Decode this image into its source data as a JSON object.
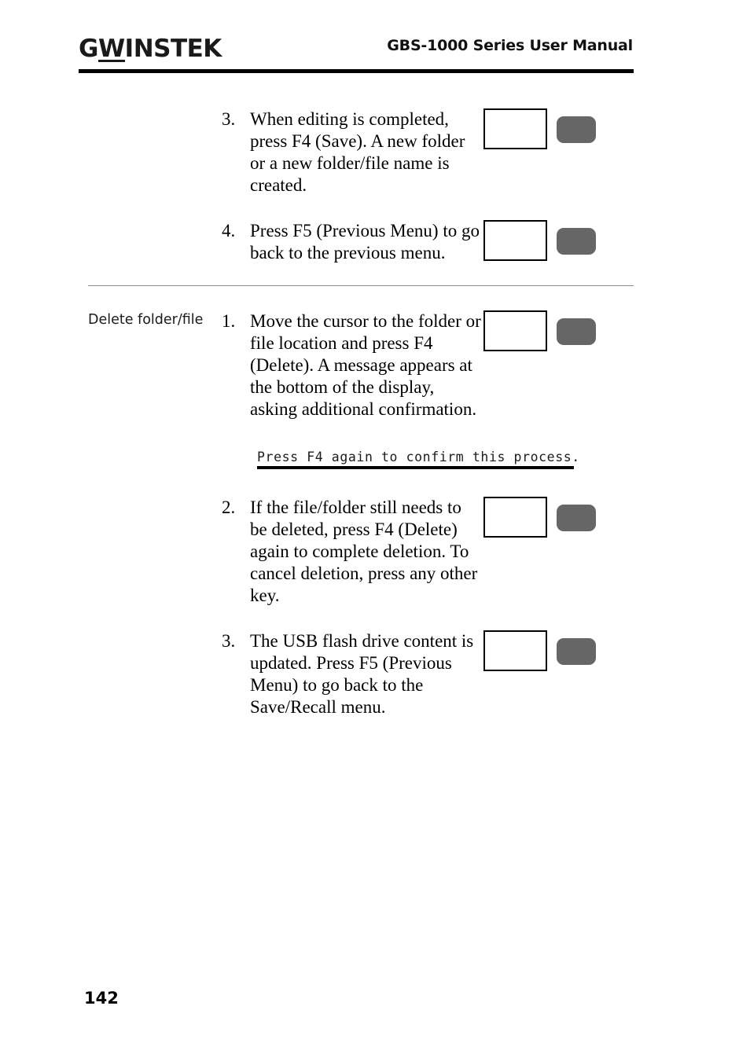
{
  "header": {
    "logo_g": "G",
    "logo_w": "W",
    "logo_rest": "INSTEK",
    "title": "GBS-1000 Series User Manual"
  },
  "sections": [
    {
      "side_label": "",
      "steps": [
        {
          "number": "3.",
          "text": "When editing is completed, press F4 (Save). A new folder or a new folder/file name is created.",
          "has_key_graphic": true
        },
        {
          "number": "4.",
          "text": "Press F5 (Previous Menu) to go back to the previous menu.",
          "has_key_graphic": true
        }
      ]
    },
    {
      "side_label": "Delete folder/file",
      "steps": [
        {
          "number": "1.",
          "text": "Move the cursor to the folder or file location and press F4 (Delete). A message appears at the bottom of the display, asking additional confirmation.",
          "has_key_graphic": true
        },
        {
          "number": "2.",
          "text": "If the file/folder still needs to be deleted, press F4 (Delete) again to complete deletion. To cancel deletion, press any other key.",
          "has_key_graphic": true
        },
        {
          "number": "3.",
          "text": "The USB flash drive content is updated. Press F5 (Previous Menu) to go back to the Save/Recall menu.",
          "has_key_graphic": true
        }
      ]
    }
  ],
  "lcd_message": {
    "text": "Press F4 again to confirm this process."
  },
  "footer": {
    "page_number": "142"
  },
  "colors": {
    "key_button_gray": "#666666",
    "rule_black": "#000000",
    "divider_gray": "#8a8a8a"
  }
}
